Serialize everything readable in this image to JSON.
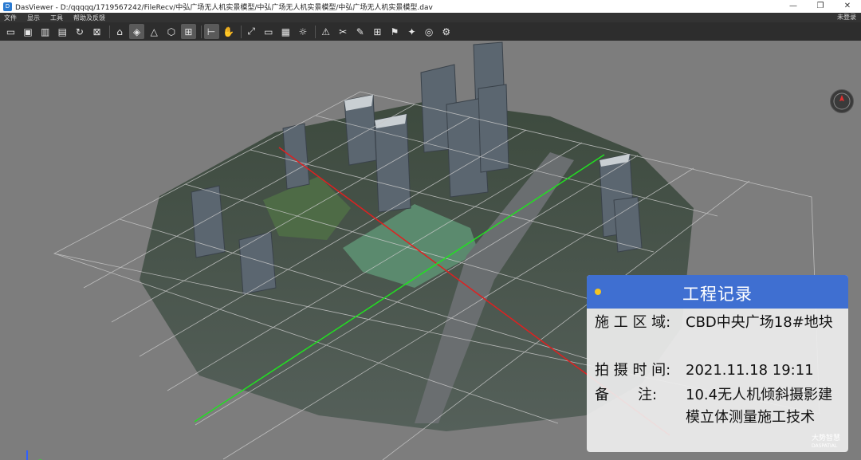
{
  "titlebar": {
    "app_icon": "dasviewer-icon",
    "title": "DasViewer - D:/qqqqq/1719567242/FileRecv/中弘广场无人机实景模型/中弘广场无人机实景模型/中弘广场无人机实景模型.dav",
    "minimize": "—",
    "restore": "❐",
    "close": "✕"
  },
  "menubar": {
    "items": [
      "文件",
      "显示",
      "工具",
      "帮助及反馈"
    ],
    "login": "未登录"
  },
  "toolbar": {
    "icons": [
      "open-folder-icon",
      "open-file-icon",
      "chart-icon",
      "save-icon",
      "refresh-icon",
      "close-file-icon",
      "home-icon",
      "layers-icon",
      "mountain-icon",
      "cube-icon",
      "crop-icon",
      "measure-icon",
      "hand-icon",
      "fullscreen-icon",
      "monitor-icon",
      "screenshot-icon",
      "light-icon",
      "ruler-icon",
      "scissors-icon",
      "pen-icon",
      "grid-icon",
      "flag-icon",
      "brush-icon",
      "pin-icon",
      "settings-icon"
    ]
  },
  "record_panel": {
    "title": "工程记录",
    "rows": [
      {
        "label": "施 工 区 域:",
        "value": "CBD中央广场18#地块"
      },
      {
        "label": "拍 摄 时 间:",
        "value": "2021.11.18 19:11"
      },
      {
        "label": "备　　注:",
        "value": "10.4无人机倾斜摄影建模立体测量施工技术"
      }
    ],
    "dot_color": "#f3c423",
    "header_color": "#3f6fd1"
  },
  "logo": {
    "text": "大势智慧",
    "sub": "DASPATIAL"
  },
  "colors": {
    "x_axis": "#e02020",
    "y_axis": "#22e022",
    "grid": "#c8c8c8"
  }
}
